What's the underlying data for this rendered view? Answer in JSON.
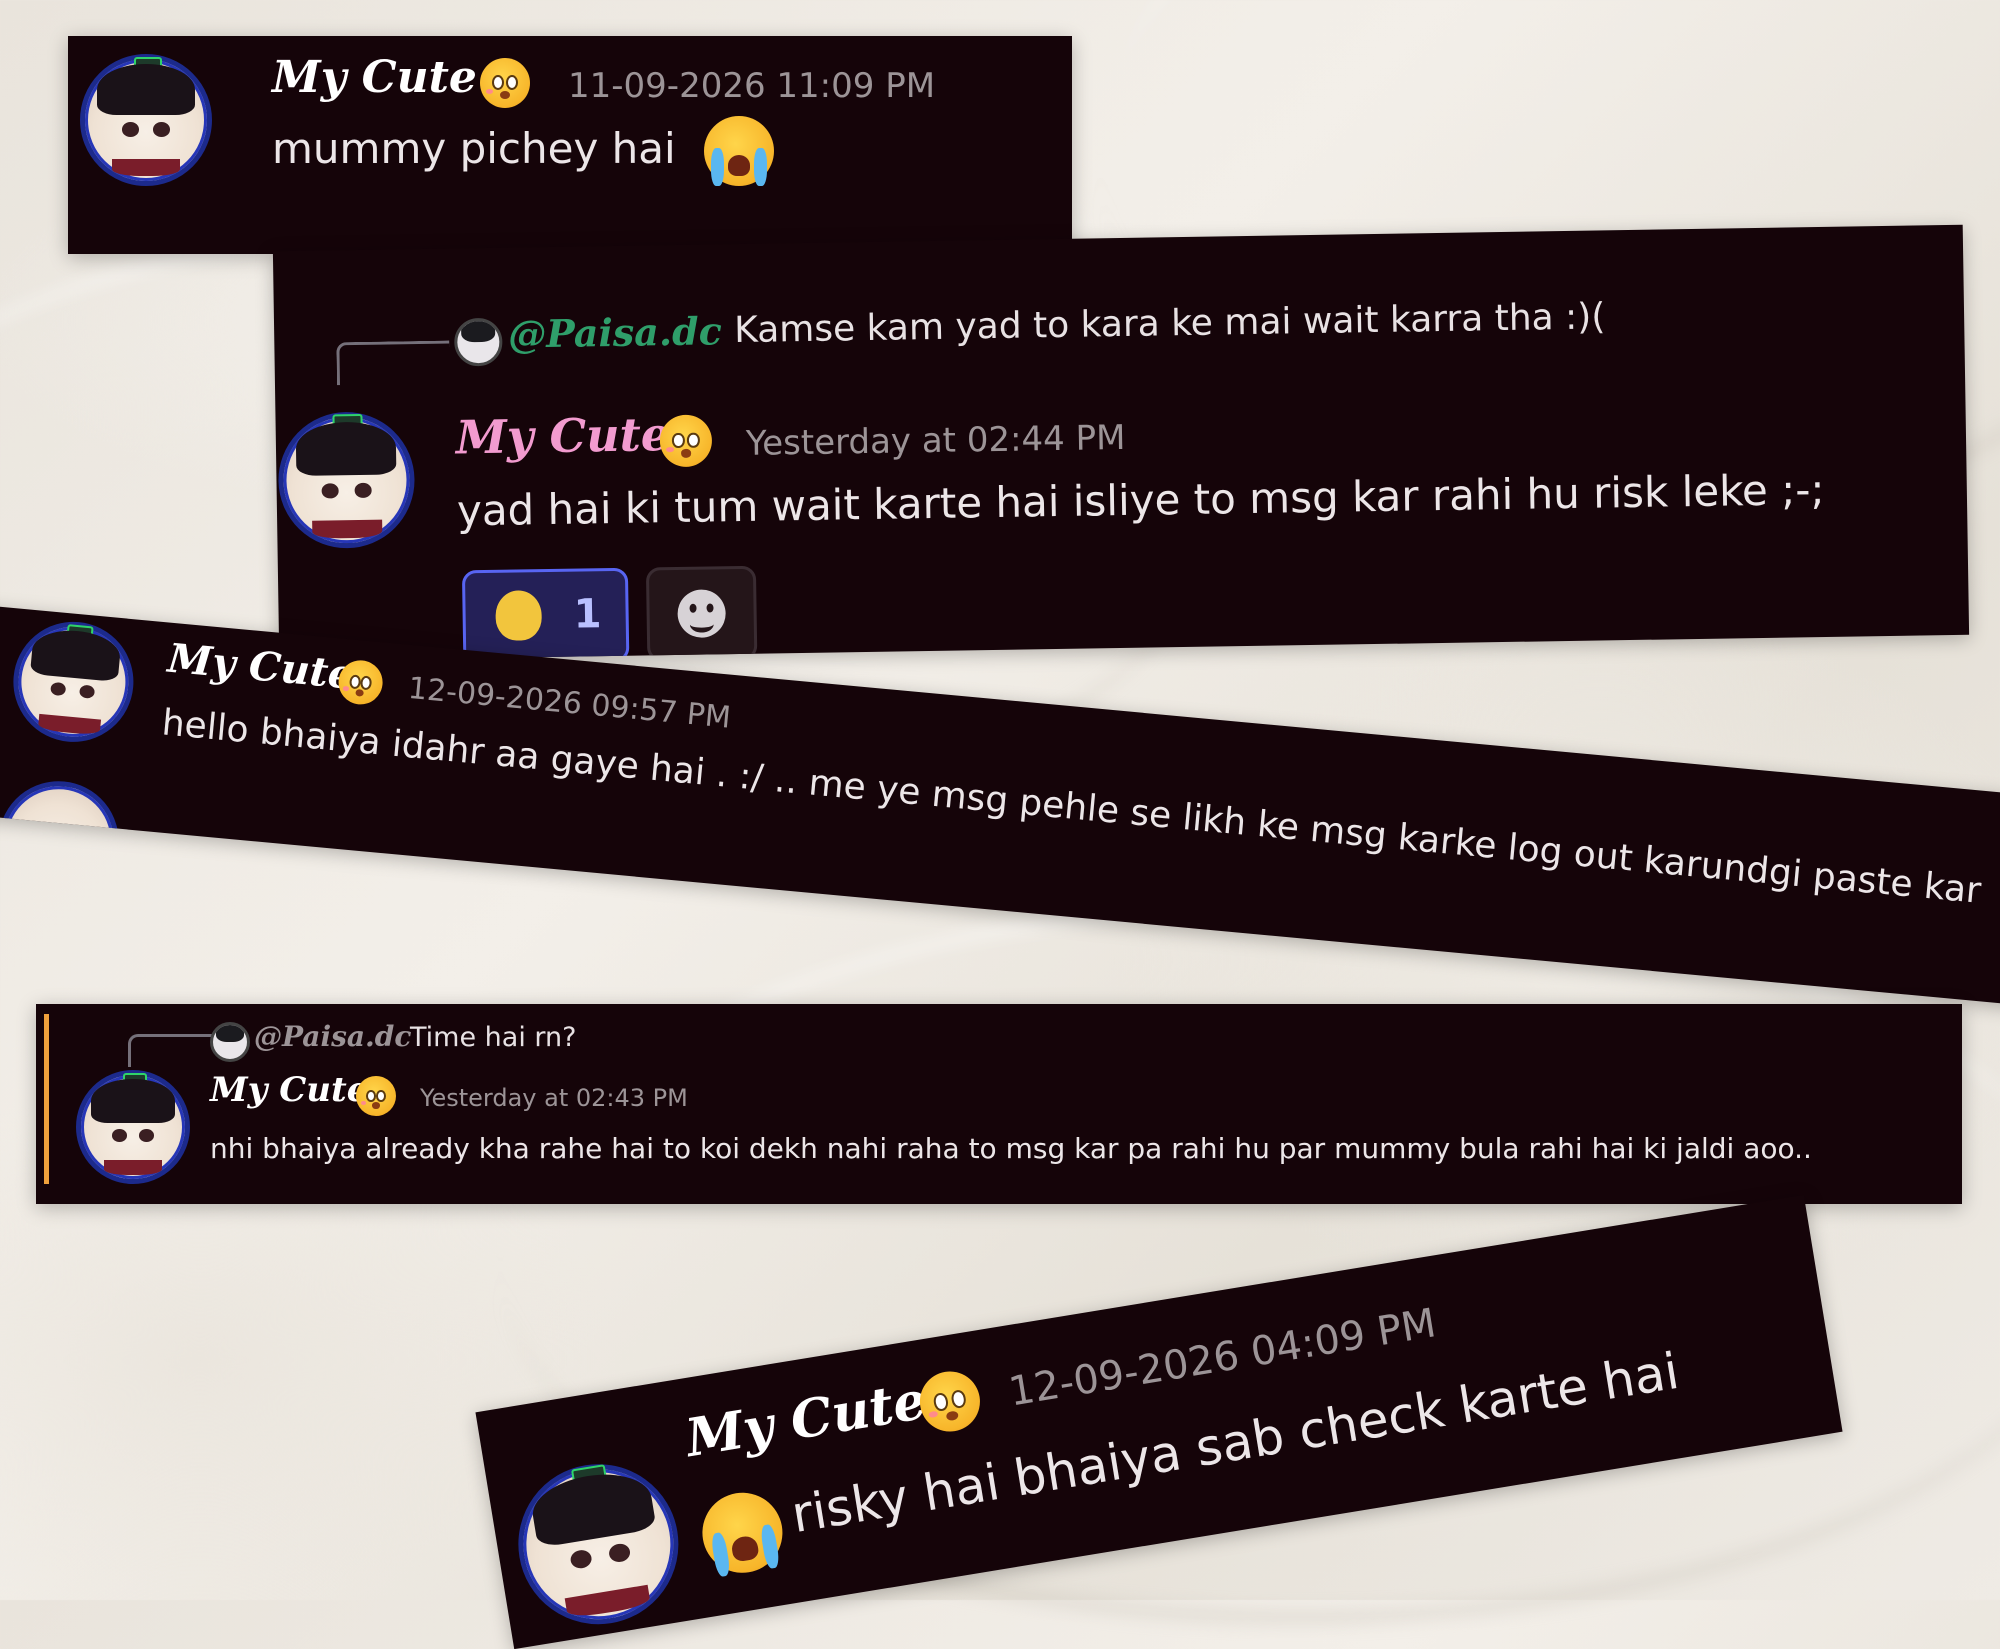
{
  "messages": [
    {
      "author": "My Cute",
      "timestamp": "11-09-2026 11:09 PM",
      "text": "mummy pichey hai",
      "text_emoji": "loudly-crying-face"
    },
    {
      "reply_to": {
        "mention": "@Paisa.dc",
        "text": "Kamse kam yad to kara ke mai wait karra tha :)("
      },
      "author": "My Cute",
      "timestamp": "Yesterday at 02:44 PM",
      "text": "yad hai ki tum wait karte hai isliye to msg kar rahi hu risk leke ;-;",
      "reactions": [
        {
          "emoji": "duck-emoji",
          "count": "1"
        }
      ],
      "add_reaction_icon": "smiley-add-reaction-icon"
    },
    {
      "author": "My Cute",
      "timestamp": "12-09-2026 09:57 PM",
      "text": "hello bhaiya idahr aa gaye hai . :/ .. me ye msg pehle se likh ke  msg karke log out karundgi paste kar"
    },
    {
      "reply_to": {
        "mention": "@Paisa.dc",
        "text": "Time hai rn?"
      },
      "author": "My Cute",
      "timestamp": "Yesterday at 02:43 PM",
      "text": "nhi bhaiya already kha rahe hai to koi dekh nahi raha to msg kar pa rahi hu par mummy bula rahi hai ki jaldi aoo.."
    },
    {
      "author": "My Cute",
      "timestamp": "12-09-2026 04:09 PM",
      "text": "risky hai bhaiya sab check karte hai",
      "text_emoji": "loudly-crying-face"
    }
  ],
  "colors": {
    "card_bg": "#150409",
    "name_pink": "#f29bcf",
    "mention_green": "#2f9e6a",
    "reaction_border": "#5865f2",
    "reply_highlight": "#f0a13c"
  }
}
